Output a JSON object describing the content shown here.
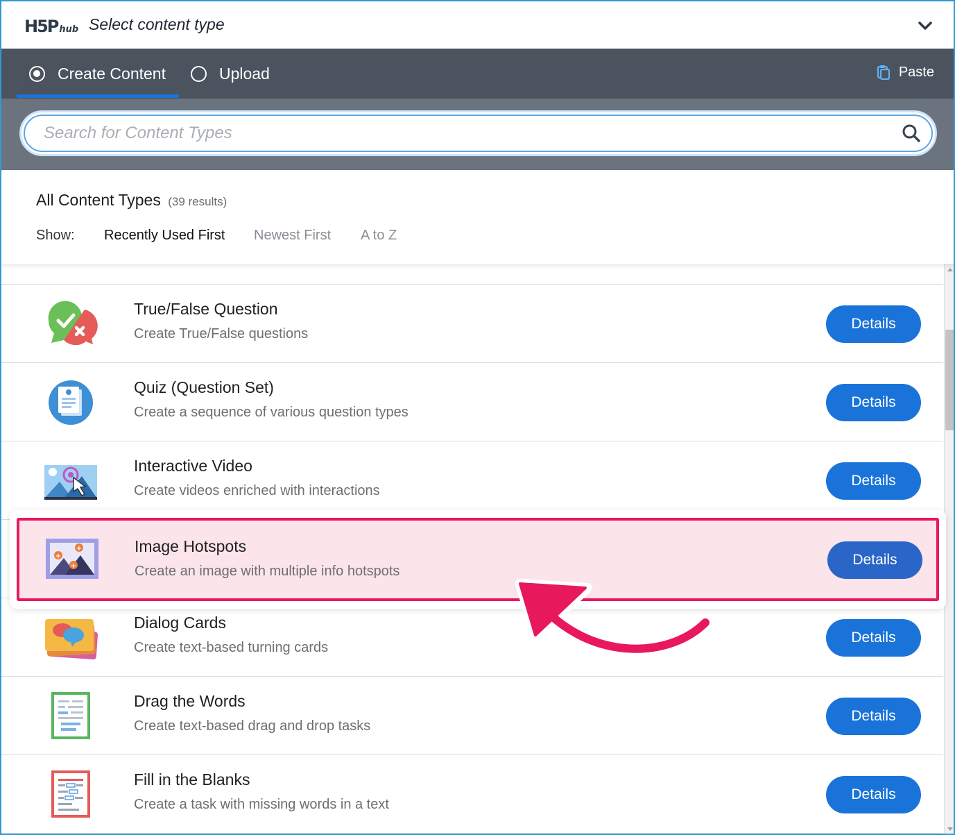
{
  "header": {
    "logo_main": "H5P",
    "logo_sub": "hub",
    "title": "Select content type"
  },
  "tabs": {
    "create_label": "Create Content",
    "upload_label": "Upload",
    "paste_label": "Paste"
  },
  "search": {
    "placeholder": "Search for Content Types",
    "value": ""
  },
  "filter": {
    "title": "All Content Types",
    "count": "(39 results)",
    "show_label": "Show:",
    "options": [
      "Recently Used First",
      "Newest First",
      "A to Z"
    ],
    "active_option": "Recently Used First"
  },
  "items": [
    {
      "title": "True/False Question",
      "desc": "Create True/False questions",
      "button": "Details",
      "icon": "true-false-icon"
    },
    {
      "title": "Quiz (Question Set)",
      "desc": "Create a sequence of various question types",
      "button": "Details",
      "icon": "quiz-icon"
    },
    {
      "title": "Interactive Video",
      "desc": "Create videos enriched with interactions",
      "button": "Details",
      "icon": "interactive-video-icon"
    },
    {
      "title": "Image Hotspots",
      "desc": "Create an image with multiple info hotspots",
      "button": "Details",
      "icon": "image-hotspots-icon",
      "highlighted": true
    },
    {
      "title": "Dialog Cards",
      "desc": "Create text-based turning cards",
      "button": "Details",
      "icon": "dialog-cards-icon"
    },
    {
      "title": "Drag the Words",
      "desc": "Create text-based drag and drop tasks",
      "button": "Details",
      "icon": "drag-the-words-icon"
    },
    {
      "title": "Fill in the Blanks",
      "desc": "Create a task with missing words in a text",
      "button": "Details",
      "icon": "fill-in-blanks-icon"
    }
  ],
  "colors": {
    "tabbar": "#4b535e",
    "search_band": "#6b737e",
    "accent": "#1a73d9",
    "highlight_border": "#e8185d",
    "highlight_fill": "#fbe4ea",
    "frame": "#2d9ad6"
  }
}
